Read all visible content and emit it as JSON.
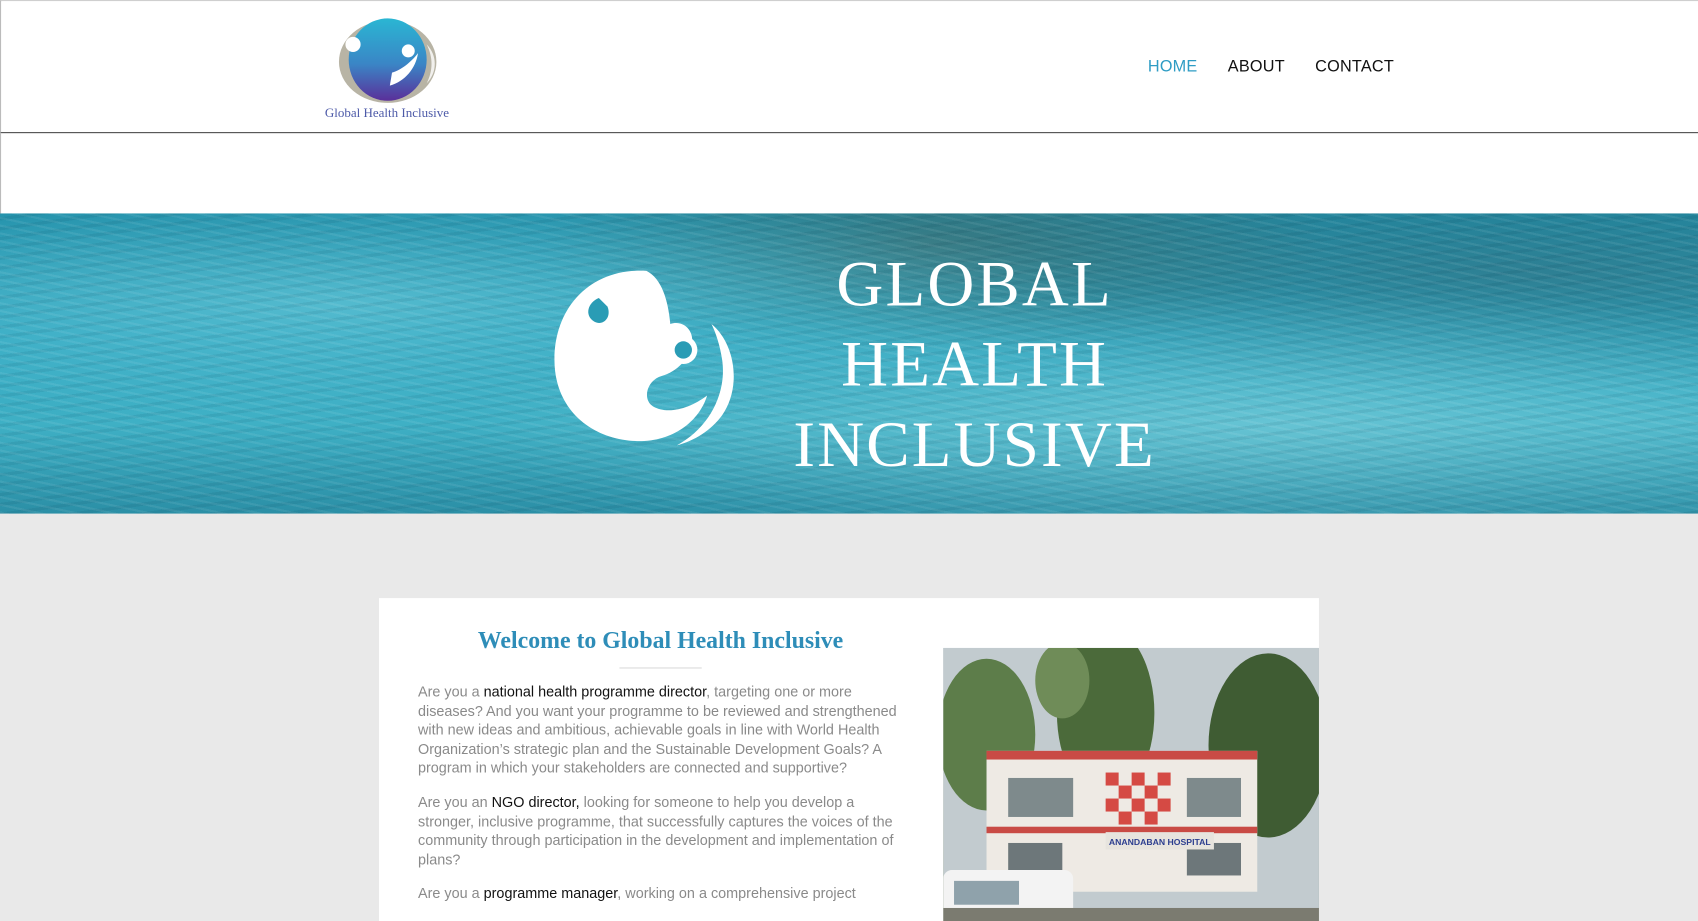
{
  "header": {
    "logo_text": "Global Health Inclusive",
    "nav": [
      {
        "label": "HOME",
        "active": true
      },
      {
        "label": "ABOUT",
        "active": false
      },
      {
        "label": "CONTACT",
        "active": false
      }
    ]
  },
  "hero": {
    "title_lines": [
      "GLOBAL",
      "HEALTH",
      "INCLUSIVE"
    ]
  },
  "content": {
    "welcome_title": "Welcome to Global Health Inclusive",
    "paragraphs": [
      {
        "pre": "Are you a ",
        "highlight": "national health programme director",
        "post": ", targeting one or more diseases? And you want your programme to be reviewed and strengthened with new ideas and ambitious, achievable goals in line with World Health Organization’s strategic plan and the Sustainable Development Goals? A program in which your stakeholders are connected and supportive?"
      },
      {
        "pre": "Are you an ",
        "highlight": "NGO director,",
        "post": " looking for someone to help you develop a stronger, inclusive programme, that successfully captures the voices of the community through participation in the development and implementation of plans?"
      },
      {
        "pre": "Are you a ",
        "highlight": "programme manager",
        "post": ", working on a comprehensive project"
      }
    ],
    "photo_sign": "ANANDABAN HOSPITAL"
  },
  "colors": {
    "accent": "#2e9cc4",
    "welcome": "#2e8db8",
    "logo_text": "#4d5aa8",
    "page_bg": "#e9e9e9"
  },
  "icons": {
    "logo": "ghi-logo-icon",
    "hero_emblem": "ghi-emblem-icon"
  }
}
